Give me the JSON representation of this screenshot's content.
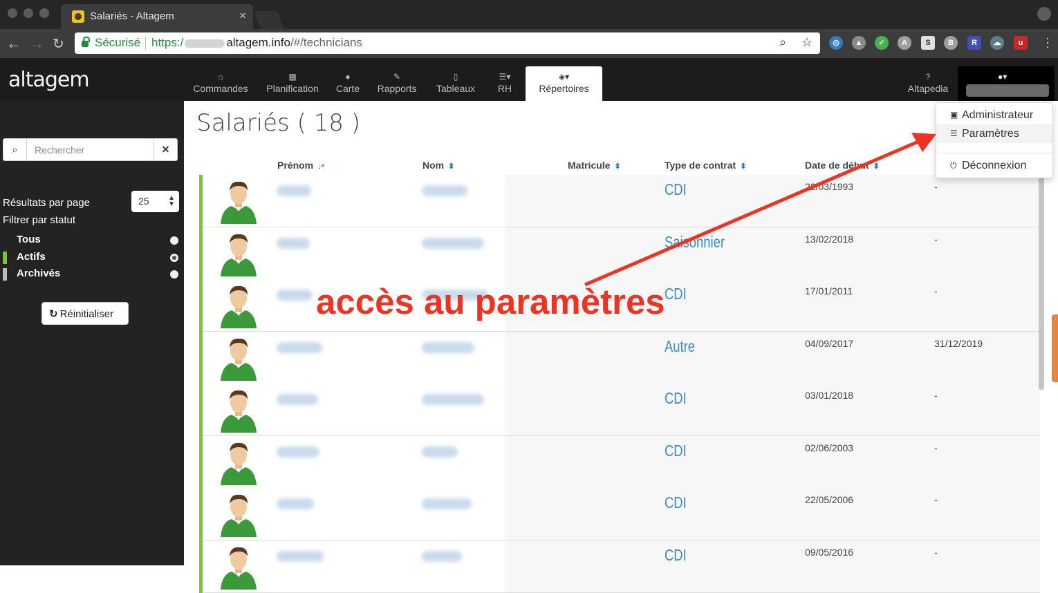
{
  "browser": {
    "tab_title": "Salariés - Altagem",
    "tab_close": "×",
    "secure_label": "Sécurisé",
    "url_scheme": "https:/",
    "url_host": "altagem.info",
    "url_path": "/#/technicians"
  },
  "app": {
    "logo": "altagem",
    "nav": [
      {
        "icon": "inbox-icon",
        "glyph": "⌂",
        "label": "Commandes"
      },
      {
        "icon": "calendar-icon",
        "glyph": "▦",
        "label": "Planification"
      },
      {
        "icon": "map-marker-icon",
        "glyph": "●",
        "label": "Carte"
      },
      {
        "icon": "edit-icon",
        "glyph": "✎",
        "label": "Rapports"
      },
      {
        "icon": "columns-icon",
        "glyph": "▯",
        "label": "Tableaux"
      },
      {
        "icon": "list-icon",
        "glyph": "☰▾",
        "label": "RH"
      },
      {
        "icon": "cube-icon",
        "glyph": "◈▾",
        "label": "Répertoires"
      }
    ],
    "help_label": "Altapedia",
    "help_glyph": "?"
  },
  "sidebar": {
    "search_placeholder": "Rechercher",
    "per_page_label": "Résultats par page",
    "per_page_value": "25",
    "filter_label": "Filtrer par statut",
    "statuses": [
      {
        "label": "Tous",
        "color": "#232323",
        "checked": false
      },
      {
        "label": "Actifs",
        "color": "#7dc242",
        "checked": true
      },
      {
        "label": "Archivés",
        "color": "#bbbbbb",
        "checked": false
      }
    ],
    "reset_label": "Réinitialiser"
  },
  "main": {
    "title": "Salariés ( 18 )",
    "columns": [
      "Prénom",
      "Nom",
      "Matricule",
      "Type de contrat",
      "Date de début"
    ],
    "rows": [
      {
        "contract": "CDI",
        "start": "22/03/1993",
        "end": "-"
      },
      {
        "contract": "Saisonnier",
        "start": "13/02/2018",
        "end": "-"
      },
      {
        "contract": "CDI",
        "start": "17/01/2011",
        "end": "-"
      },
      {
        "contract": "Autre",
        "start": "04/09/2017",
        "end": "31/12/2019"
      },
      {
        "contract": "CDI",
        "start": "03/01/2018",
        "end": "-"
      },
      {
        "contract": "CDI",
        "start": "02/06/2003",
        "end": "-"
      },
      {
        "contract": "CDI",
        "start": "22/05/2006",
        "end": "-"
      },
      {
        "contract": "CDI",
        "start": "09/05/2016",
        "end": "-"
      }
    ]
  },
  "dropdown": {
    "items": [
      {
        "icon": "lock-icon",
        "glyph": "🔒",
        "label": "Administrateur"
      },
      {
        "icon": "sliders-icon",
        "glyph": "☰",
        "label": "Paramètres"
      },
      {
        "icon": "power-icon",
        "glyph": "⏻",
        "label": "Déconnexion"
      }
    ]
  },
  "annotation": {
    "text": "accès au paramètres",
    "color": "#ee3322"
  }
}
